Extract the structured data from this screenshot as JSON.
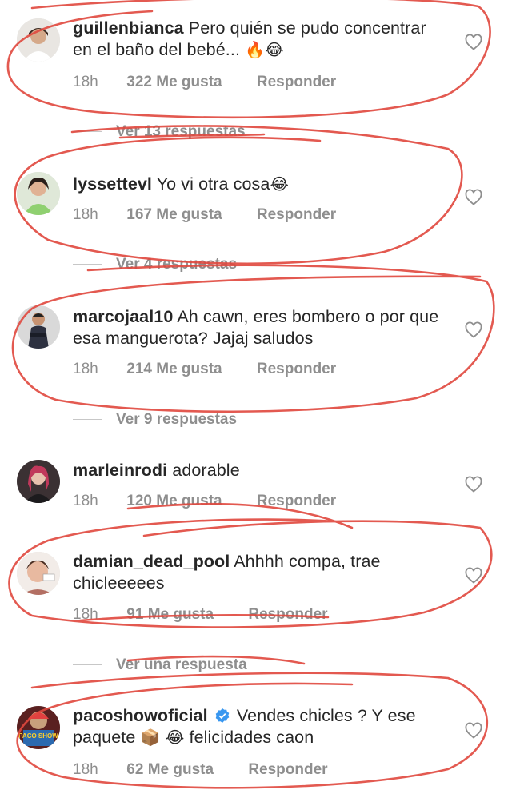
{
  "comments": [
    {
      "username": "guillenbianca",
      "text": "Pero quién se pudo concentrar en el baño del bebé...",
      "emoji": "🔥😂",
      "time": "18h",
      "likes": "322 Me gusta",
      "reply": "Responder",
      "replies": "Ver 13 respuestas",
      "avatar_icon": "avatar-icon"
    },
    {
      "username": "lyssettevl",
      "text": "Yo vi otra cosa",
      "emoji": "😂",
      "time": "18h",
      "likes": "167 Me gusta",
      "reply": "Responder",
      "replies": "Ver 4 respuestas",
      "avatar_icon": "avatar-icon"
    },
    {
      "username": "marcojaal10",
      "text": "Ah cawn, eres bombero o por que esa manguerota? Jajaj saludos",
      "time": "18h",
      "likes": "214 Me gusta",
      "reply": "Responder",
      "replies": "Ver 9 respuestas",
      "avatar_icon": "avatar-icon"
    },
    {
      "username": "marleinrodi",
      "text": "adorable",
      "time": "18h",
      "likes": "120 Me gusta",
      "reply": "Responder",
      "avatar_icon": "avatar-icon"
    },
    {
      "username": "damian_dead_pool",
      "text": "Ahhhh compa, trae chicleeeees",
      "time": "18h",
      "likes": "91 Me gusta",
      "reply": "Responder",
      "replies": "Ver una respuesta",
      "avatar_icon": "avatar-icon"
    },
    {
      "username": "pacoshowoficial",
      "text_part1": "Vendes chicles ? Y ese paquete",
      "emoji_mid": "📦 😂",
      "text_part2": "felicidades caon",
      "time": "18h",
      "likes": "62 Me gusta",
      "reply": "Responder",
      "avatar_label": "PACO SHOW",
      "verified_icon": "verified-badge-icon"
    }
  ],
  "icons": {
    "like": "heart-outline-icon"
  },
  "colors": {
    "scribble": "#e0483e",
    "meta": "#8e8e8e",
    "text": "#262626",
    "verified": "#3897f0"
  }
}
